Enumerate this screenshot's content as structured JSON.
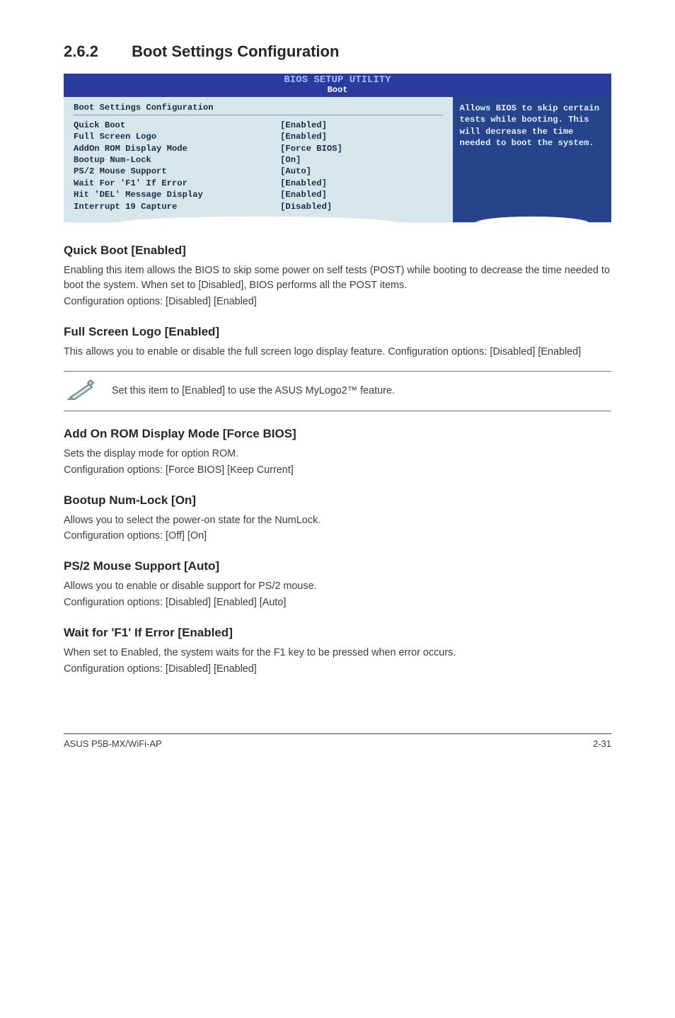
{
  "section": {
    "number": "2.6.2",
    "title": "Boot Settings Configuration"
  },
  "bios": {
    "header_top": "BIOS SETUP UTILITY",
    "header_sub": "Boot",
    "panel_title": "Boot Settings Configuration",
    "items": [
      {
        "label": "Quick Boot",
        "value": "[Enabled]"
      },
      {
        "label": "Full Screen Logo",
        "value": "[Enabled]"
      },
      {
        "label": "AddOn ROM Display Mode",
        "value": "[Force BIOS]"
      },
      {
        "label": "Bootup Num-Lock",
        "value": "[On]"
      },
      {
        "label": "PS/2 Mouse Support",
        "value": "[Auto]"
      },
      {
        "label": "Wait For 'F1' If Error",
        "value": "[Enabled]"
      },
      {
        "label": "Hit 'DEL' Message Display",
        "value": "[Enabled]"
      },
      {
        "label": "Interrupt 19 Capture",
        "value": "[Disabled]"
      }
    ],
    "help": "Allows BIOS to skip certain tests while booting. This will decrease the time needed to boot the system."
  },
  "subsections": {
    "quick_boot": {
      "heading": "Quick Boot [Enabled]",
      "p1": "Enabling this item allows the BIOS to skip some power on self tests (POST) while booting to decrease the time needed to boot the system. When set to [Disabled], BIOS performs all the POST items.",
      "p2": "Configuration options: [Disabled] [Enabled]"
    },
    "full_screen_logo": {
      "heading": "Full Screen Logo [Enabled]",
      "p1": "This allows you to enable or disable the full screen logo display feature. Configuration options: [Disabled] [Enabled]"
    },
    "note": {
      "text": "Set this item to [Enabled] to use the ASUS MyLogo2™ feature."
    },
    "addon_rom": {
      "heading": "Add On ROM Display Mode [Force BIOS]",
      "p1": "Sets the display mode for option ROM.",
      "p2": "Configuration options: [Force BIOS] [Keep Current]"
    },
    "bootup_numlock": {
      "heading": "Bootup Num-Lock [On]",
      "p1": "Allows you to select the power-on state for the NumLock.",
      "p2": "Configuration options: [Off] [On]"
    },
    "ps2_mouse": {
      "heading": "PS/2 Mouse Support [Auto]",
      "p1": "Allows you to enable or disable support for PS/2 mouse.",
      "p2": "Configuration options: [Disabled] [Enabled] [Auto]"
    },
    "wait_f1": {
      "heading": "Wait for 'F1' If Error [Enabled]",
      "p1": "When set to Enabled, the system waits for the F1 key to be pressed when error occurs.",
      "p2": "Configuration options: [Disabled] [Enabled]"
    }
  },
  "footer": {
    "left": "ASUS P5B-MX/WiFi-AP",
    "right": "2-31"
  }
}
